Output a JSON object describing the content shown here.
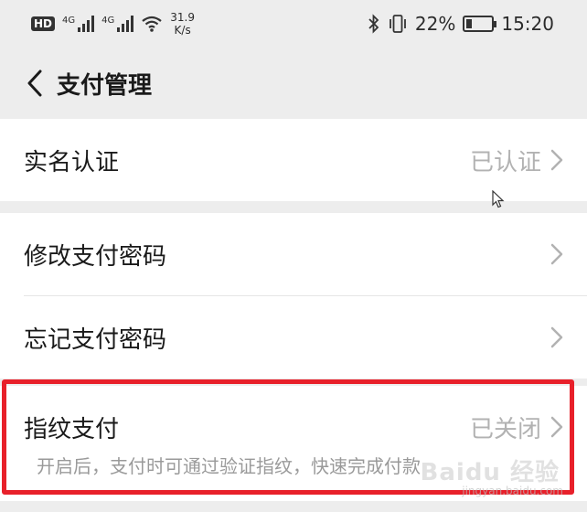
{
  "status_bar": {
    "hd": "HD",
    "sim1_gen": "4G",
    "sim2_gen": "4G",
    "net_speed_value": "31.9",
    "net_speed_unit": "K/s",
    "battery_percent": "22%",
    "time": "15:20",
    "battery_level": 0.22
  },
  "nav": {
    "title": "支付管理"
  },
  "groups": {
    "identity": {
      "label": "实名认证",
      "value": "已认证"
    },
    "password": {
      "change_label": "修改支付密码",
      "forgot_label": "忘记支付密码"
    },
    "fingerprint": {
      "label": "指纹支付",
      "value": "已关闭",
      "description": "开启后，支付时可通过验证指纹，快速完成付款"
    }
  },
  "watermark": {
    "brand": "Baidu 经验",
    "url": "jingyan.baidu.com"
  },
  "colors": {
    "highlight_border": "#e8202a",
    "background": "#ededed",
    "muted_text": "#b2b2b2"
  }
}
